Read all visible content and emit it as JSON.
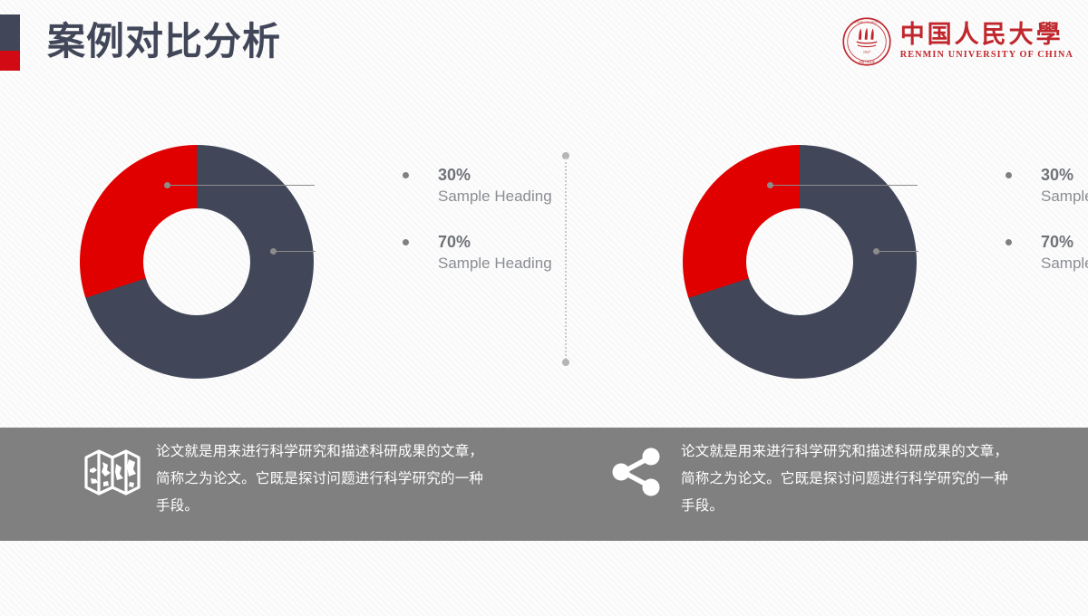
{
  "header": {
    "title": "案例对比分析",
    "accent_top_color": "#414759",
    "accent_bottom_color": "#d10a14"
  },
  "logo": {
    "seal_name": "renmin-university-seal-icon",
    "name_cn": "中国人民大學",
    "name_en": "RENMIN UNIVERSITY OF CHINA",
    "color": "#c0272d"
  },
  "theme": {
    "navy": "#414759",
    "red": "#e00000",
    "band_gray": "#808080",
    "label_gray": "#8a8d92",
    "value_gray": "#6f7277",
    "leader_gray": "#8c8c8c"
  },
  "chart_data": [
    {
      "type": "pie",
      "id": "donut-left",
      "title": "",
      "labels": [
        "30%",
        "70%"
      ],
      "values": [
        30,
        70
      ],
      "headings": [
        "Sample Heading",
        "Sample Heading"
      ],
      "colors": [
        "#e00000",
        "#414759"
      ],
      "donut": true,
      "legend": "right-callouts"
    },
    {
      "type": "pie",
      "id": "donut-right",
      "title": "",
      "labels": [
        "30%",
        "70%"
      ],
      "values": [
        30,
        70
      ],
      "headings": [
        "Sample Heading",
        "Sample Heading"
      ],
      "colors": [
        "#e00000",
        "#414759"
      ],
      "donut": true,
      "legend": "right-callouts"
    }
  ],
  "panels": {
    "left": {
      "callouts": [
        {
          "value": "30%",
          "heading": "Sample Heading"
        },
        {
          "value": "70%",
          "heading": "Sample Heading"
        }
      ]
    },
    "right": {
      "callouts": [
        {
          "value": "30%",
          "heading": "Sample Heading"
        },
        {
          "value": "70%",
          "heading": "Sample Heading"
        }
      ]
    }
  },
  "footer": {
    "left": {
      "icon": "map-icon",
      "text": "论文就是用来进行科学研究和描述科研成果的文章，简称之为论文。它既是探讨问题进行科学研究的一种手段。"
    },
    "right": {
      "icon": "share-icon",
      "text": "论文就是用来进行科学研究和描述科研成果的文章，简称之为论文。它既是探讨问题进行科学研究的一种手段。"
    }
  }
}
